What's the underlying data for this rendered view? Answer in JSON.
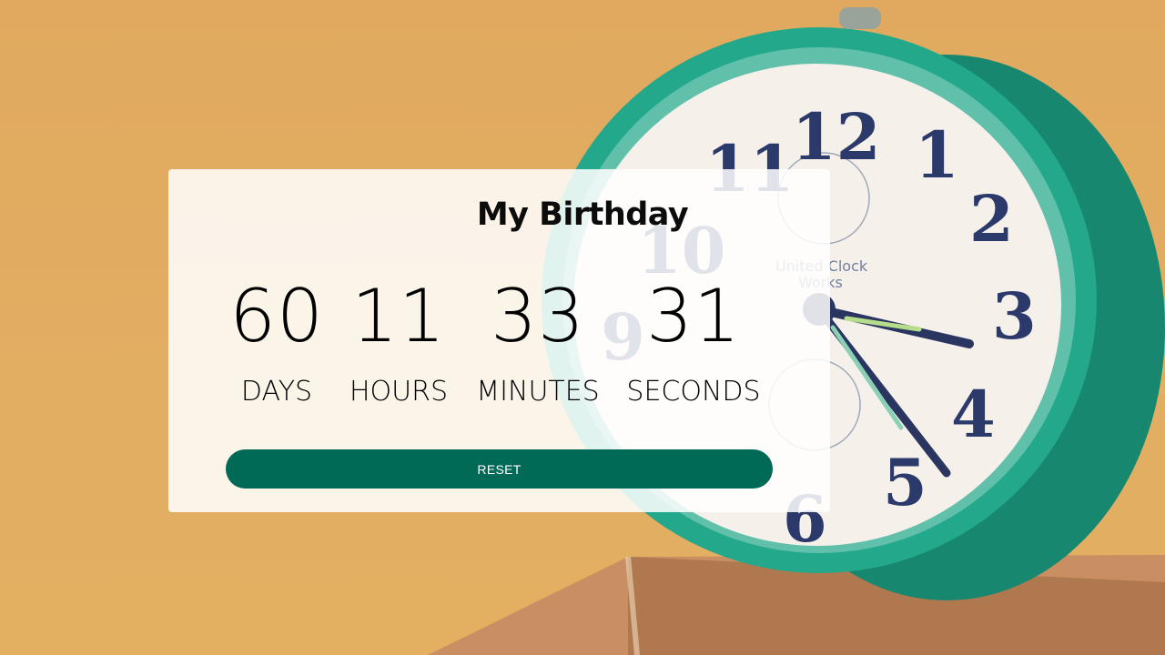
{
  "background": {
    "description_icon": "alarm-clock-photo",
    "colors": {
      "wall": "#e0a95f",
      "clock_body": "#1e9f85",
      "clock_face": "#f4f0e8",
      "book": "#c98b5a"
    }
  },
  "countdown": {
    "title": "My Birthday",
    "units": [
      {
        "value": "60",
        "label": "DAYS"
      },
      {
        "value": "11",
        "label": "HOURS"
      },
      {
        "value": "33",
        "label": "MINUTES"
      },
      {
        "value": "31",
        "label": "SECONDS"
      }
    ],
    "reset_label": "RESET",
    "accent": "#006a56"
  }
}
